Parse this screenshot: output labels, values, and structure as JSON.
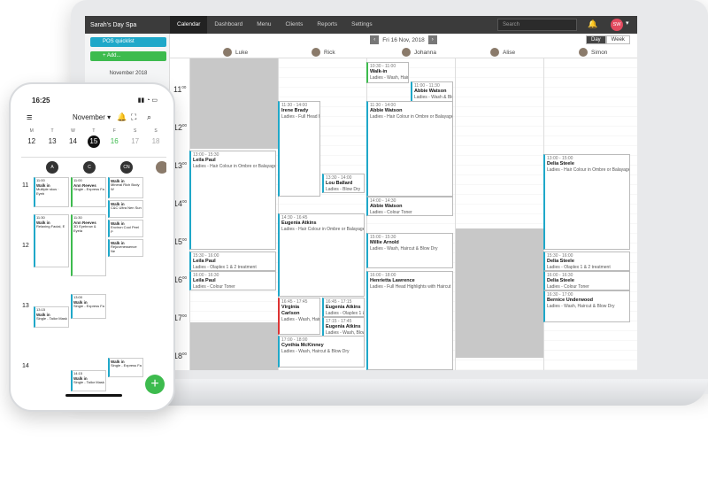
{
  "app": {
    "brand": "Sarah's Day Spa",
    "tabs": [
      "Calendar",
      "Dashboard",
      "Menu",
      "Clients",
      "Reports",
      "Settings"
    ],
    "search_placeholder": "Search",
    "user_initials": "SW"
  },
  "sidebar": {
    "pos_label": "POS quicklist",
    "add_label": "+ Add...",
    "month_label": "November 2018"
  },
  "datebar": {
    "prev": "‹",
    "date_label": "Fri 16 Nov, 2018",
    "next": "›",
    "day": "Day",
    "week": "Week"
  },
  "staff": [
    "Luke",
    "Rick",
    "Johanna",
    "Alise",
    "Simon"
  ],
  "hours": [
    "11",
    "12",
    "13",
    "14",
    "15",
    "16",
    "17",
    "18"
  ],
  "appointments": [
    {
      "t": "10:30 - 11:00",
      "name": "Walk-in",
      "s": "Ladies - Wash, Hairc"
    },
    {
      "t": "11:00 - 11:30",
      "name": "Abbie Watson",
      "s": "Ladies - Wash & Blo"
    },
    {
      "t": "11:30 - 14:00",
      "name": "Irene Brady",
      "s": "Ladies - Full Head Hi"
    },
    {
      "t": "11:30 - 14:00",
      "name": "Abbie Watson",
      "s": "Ladies - Hair Colour in Ombre or Balayage"
    },
    {
      "t": "13:00 - 15:30",
      "name": "Leila Paul",
      "s": "Ladies - Hair Colour in Ombre or Balayage"
    },
    {
      "t": "13:30 - 14:00",
      "name": "Lou Ballard",
      "s": "Ladies - Blow Dry"
    },
    {
      "t": "13:00 - 15:00",
      "name": "Delia Steele",
      "s": "Ladies - Hair Colour in Ombre or Balayage"
    },
    {
      "t": "14:00 - 14:30",
      "name": "Abbie Watson",
      "s": "Ladies - Colour Toner"
    },
    {
      "t": "14:30 - 16:45",
      "name": "Eugenia Atkins",
      "s": "Ladies - Hair Colour in Ombre or Balayage"
    },
    {
      "t": "15:00 - 15:30",
      "name": "Millie Arnold",
      "s": "Ladies - Wash, Haircut & Blow Dry"
    },
    {
      "t": "15:30 - 16:00",
      "name": "Leila Paul",
      "s": "Ladies - Olaplex 1 & 2 treatment"
    },
    {
      "t": "15:30 - 16:00",
      "name": "Delia Steele",
      "s": "Ladies - Olaplex 1 & 2 treatment"
    },
    {
      "t": "16:00 - 16:30",
      "name": "Leila Paul",
      "s": "Ladies - Colour Toner"
    },
    {
      "t": "16:00 - 18:00",
      "name": "Henrietta Lawrence",
      "s": "Ladies - Full Head Highlights with Haircut an"
    },
    {
      "t": "16:00 - 16:30",
      "name": "Delia Steele",
      "s": "Ladies - Colour Toner"
    },
    {
      "t": "16:30 - 17:00",
      "name": "Bernice Underwood",
      "s": "Ladies - Wash, Haircut & Blow Dry"
    },
    {
      "t": "16:45 - 17:45",
      "name": "Virginia Carlson",
      "s": "Ladies - Wash, Haircu"
    },
    {
      "t": "16:45 - 17:15",
      "name": "Eugenia Atkins",
      "s": "Ladies - Olaplex 1 &"
    },
    {
      "t": "17:15 - 17:45",
      "name": "Eugenia Atkins",
      "s": "Ladies - Wash, Blow"
    },
    {
      "t": "17:00 - 18:00",
      "name": "Cynthia McKinney",
      "s": "Ladies - Wash, Haircut & Blow Dry"
    }
  ],
  "phone": {
    "time": "16:25",
    "month": "November",
    "week": [
      {
        "l": "M",
        "n": "12"
      },
      {
        "l": "T",
        "n": "13"
      },
      {
        "l": "W",
        "n": "14"
      },
      {
        "l": "T",
        "n": "15"
      },
      {
        "l": "F",
        "n": "16"
      },
      {
        "l": "S",
        "n": "17"
      },
      {
        "l": "S",
        "n": "18"
      }
    ],
    "avatars": [
      "A",
      "C",
      "CN"
    ],
    "hours": [
      "11",
      "12",
      "13",
      "14"
    ],
    "appointments": [
      {
        "t": "11:00",
        "name": "Walk in",
        "s": "Multiple skus · Eyeb"
      },
      {
        "t": "11:00",
        "name": "Ann Reeves",
        "s": "Single - Express Fa"
      },
      {
        "t": "",
        "name": "Walk in",
        "s": "Mineral Rich Body W"
      },
      {
        "t": "",
        "name": "Walk in",
        "s": "C&C Ultra Nen Sun"
      },
      {
        "t": "11:30",
        "name": "Walk in",
        "s": "Relaxing Facial, E"
      },
      {
        "t": "11:30",
        "name": "Ann Reeves",
        "s": "3D Eyebrow & Eyela"
      },
      {
        "t": "",
        "name": "Walk in",
        "s": "Environ Cool Peel P"
      },
      {
        "t": "",
        "name": "Walk in",
        "s": "Rejuvenessence Ne"
      },
      {
        "t": "13:00",
        "name": "Walk in",
        "s": "Single - Express Fa"
      },
      {
        "t": "13:15",
        "name": "Walk in",
        "s": "Single - Tailor Mask"
      },
      {
        "t": "",
        "name": "Walk in",
        "s": "Single - Express Fa"
      },
      {
        "t": "14:15",
        "name": "Walk in",
        "s": "Single - Tailor Mask"
      }
    ]
  }
}
